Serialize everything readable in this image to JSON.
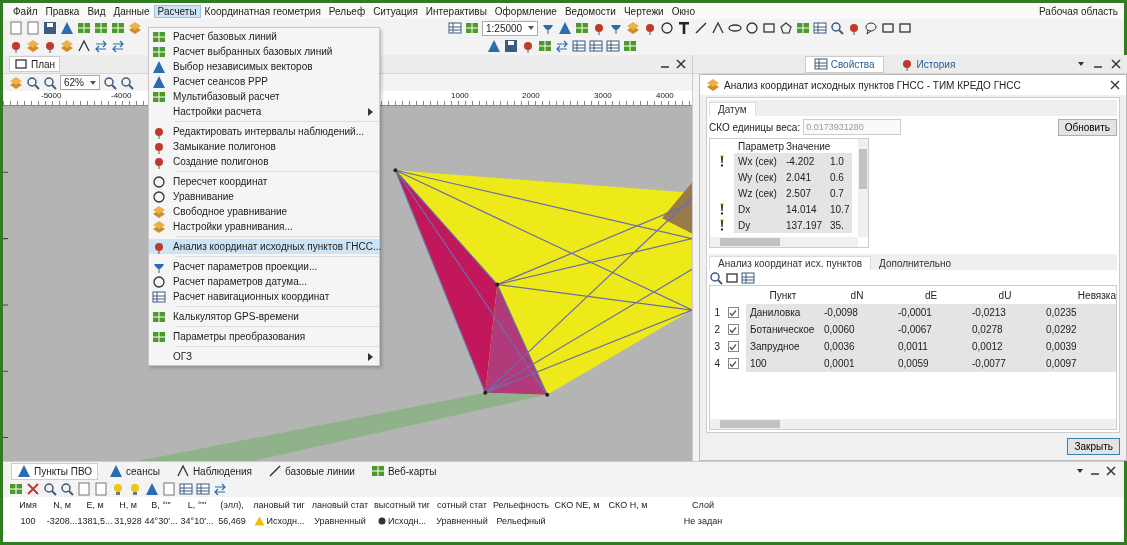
{
  "menu_bar": {
    "items": [
      {
        "label": "Файл",
        "selected": false
      },
      {
        "label": "Правка",
        "selected": false
      },
      {
        "label": "Вид",
        "selected": false
      },
      {
        "label": "Данные",
        "selected": false
      },
      {
        "label": "Расчеты",
        "selected": true
      },
      {
        "label": "Координатная геометрия",
        "selected": false
      },
      {
        "label": "Рельеф",
        "selected": false
      },
      {
        "label": "Ситуация",
        "selected": false
      },
      {
        "label": "Интерактивы",
        "selected": false
      },
      {
        "label": "Оформление",
        "selected": false
      },
      {
        "label": "Ведомости",
        "selected": false
      },
      {
        "label": "Чертежи",
        "selected": false
      },
      {
        "label": "Окно",
        "selected": false
      }
    ],
    "workspace": "Рабочая область"
  },
  "toolbar": {
    "scale": "1:25000"
  },
  "plan_panel": {
    "title": "План",
    "zoom": "62%",
    "ruler_labels": [
      "-5000",
      "-4000",
      "1000",
      "2000",
      "3000",
      "4000"
    ]
  },
  "calc_menu": {
    "items": [
      {
        "kind": "command",
        "label": "Расчет базовых линий",
        "selected": false
      },
      {
        "kind": "command",
        "label": "Расчет выбранных базовых линий",
        "selected": false
      },
      {
        "kind": "command",
        "label": "Выбор независимых векторов",
        "selected": false
      },
      {
        "kind": "command",
        "label": "Расчет сеансов PPP",
        "selected": false
      },
      {
        "kind": "command",
        "label": "Мультибазовый расчет",
        "selected": false
      },
      {
        "kind": "submenu",
        "label": "Настройки расчета",
        "selected": false
      },
      {
        "kind": "separator"
      },
      {
        "kind": "command",
        "label": "Редактировать интервалы наблюдений...",
        "selected": false
      },
      {
        "kind": "command",
        "label": "Замыкание полигонов",
        "selected": false
      },
      {
        "kind": "command",
        "label": "Создание полигонов",
        "selected": false
      },
      {
        "kind": "separator"
      },
      {
        "kind": "command",
        "label": "Пересчет координат",
        "selected": false
      },
      {
        "kind": "command",
        "label": "Уравнивание",
        "selected": false
      },
      {
        "kind": "command",
        "label": "Свободное уравнивание",
        "selected": false
      },
      {
        "kind": "command",
        "label": "Настройки уравнивания...",
        "selected": false
      },
      {
        "kind": "separator"
      },
      {
        "kind": "command",
        "label": "Анализ координат исходных пунктов ГНСС...",
        "selected": true
      },
      {
        "kind": "separator"
      },
      {
        "kind": "command",
        "label": "Расчет параметров проекции...",
        "selected": false
      },
      {
        "kind": "command",
        "label": "Расчет параметров датума...",
        "selected": false
      },
      {
        "kind": "command",
        "label": "Расчет навигационных координат",
        "selected": false
      },
      {
        "kind": "separator"
      },
      {
        "kind": "command",
        "label": "Калькулятор GPS-времени",
        "selected": false
      },
      {
        "kind": "separator"
      },
      {
        "kind": "command",
        "label": "Параметры преобразования",
        "selected": false
      },
      {
        "kind": "separator"
      },
      {
        "kind": "submenu",
        "label": "ОГЗ",
        "selected": false
      }
    ]
  },
  "properties_panel": {
    "tabs": [
      {
        "label": "Свойства",
        "selected": true
      },
      {
        "label": "История",
        "selected": false
      }
    ]
  },
  "dialog": {
    "title": "Анализ координат исходных пунктов ГНСС - ТИМ КРЕДО ГНСС",
    "tab": "Датум",
    "weight_label": "СКО единицы веса:",
    "weight_value": "0.0173931280",
    "refresh_button": "Обновить",
    "params": {
      "columns": [
        "Параметр",
        "Значение"
      ],
      "rows": [
        {
          "warning": true,
          "param": "Wx (сек)",
          "value": "-4.202",
          "column_3": "1.0"
        },
        {
          "warning": false,
          "param": "Wy (сек)",
          "value": "2.041",
          "column_3": "0.6"
        },
        {
          "warning": false,
          "param": "Wz (сек)",
          "value": "2.507",
          "column_3": "0.7"
        },
        {
          "warning": true,
          "param": "Dx",
          "value": "14.014",
          "column_3": "10.7"
        },
        {
          "warning": true,
          "param": "Dy",
          "value": "137.197",
          "column_3": "35."
        }
      ]
    },
    "tabs": [
      {
        "label": "Анализ координат исх. пунктов",
        "selected": true
      },
      {
        "label": "Дополнительно",
        "selected": false
      }
    ],
    "table": {
      "columns": [
        "Пункт",
        "dN",
        "dE",
        "dU",
        "Невязка"
      ],
      "rows": [
        {
          "number": "1",
          "checked": true,
          "cells": [
            "Даниловка",
            "-0,0098",
            "-0,0001",
            "-0,0213",
            "0,0235"
          ]
        },
        {
          "number": "2",
          "checked": true,
          "cells": [
            "Ботаническое",
            "0,0060",
            "-0,0067",
            "0,0278",
            "0,0292"
          ]
        },
        {
          "number": "3",
          "checked": true,
          "cells": [
            "Запрудное",
            "0,0036",
            "0,0011",
            "0,0012",
            "0,0039"
          ]
        },
        {
          "number": "4",
          "checked": true,
          "cells": [
            "100",
            "0,0001",
            "0,0059",
            "-0,0077",
            "0,0097"
          ]
        }
      ]
    },
    "close_button": "Закрыть"
  },
  "bottom_panel": {
    "tabs": [
      {
        "label": "Пункты ПВО",
        "selected": true
      },
      {
        "label": "сеансы",
        "selected": false
      },
      {
        "label": "Наблюдения",
        "selected": false
      },
      {
        "label": "базовые линии",
        "selected": false
      },
      {
        "label": "Веб-карты",
        "selected": false
      }
    ],
    "table": {
      "columns": [
        "Имя",
        "N, м",
        "E, м",
        "H, м",
        "B, °'\"",
        "L, °'\"",
        "(элл),",
        "лановый тиг",
        "лановый стат",
        "высотный тиг",
        "сотный стат",
        "Рельефность",
        "СКО NE, м",
        "СКО H, м",
        "Слой"
      ],
      "rows": [
        {
          "cells": [
            "100",
            "-3208...",
            "1381,5...",
            "31,928",
            "44°30'...",
            "34°10'...",
            "56,469",
            "Исходн...",
            "Уравненный",
            "Исходн...",
            "Уравненный",
            "Рельефный",
            "",
            "",
            "Не задан"
          ]
        }
      ]
    }
  }
}
